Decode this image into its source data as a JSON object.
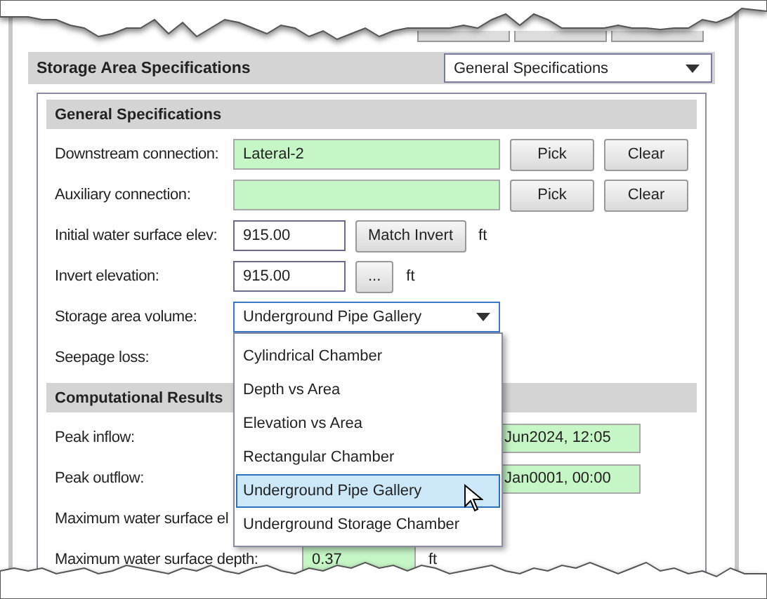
{
  "toolbar": {
    "buttons": [
      {
        "kind": "button"
      },
      {
        "kind": "button"
      },
      {
        "kind": "button"
      }
    ]
  },
  "panel": {
    "title": "Storage Area Specifications",
    "view_select": {
      "value": "General Specifications"
    }
  },
  "general": {
    "title": "General Specifications",
    "rows": [
      {
        "kind": "connection",
        "label": "Downstream connection:",
        "value": "Lateral-2",
        "buttons": [
          "Pick",
          "Clear"
        ]
      },
      {
        "kind": "connection",
        "label": "Auxiliary connection:",
        "buttons": [
          "Pick",
          "Clear"
        ]
      },
      {
        "kind": "elevation",
        "label": "Initial water surface elev:",
        "value": "915.00",
        "button": "Match Invert",
        "unit": "ft"
      },
      {
        "kind": "elevation",
        "label": "Invert elevation:",
        "value": "915.00",
        "button": "...",
        "unit": "ft"
      },
      {
        "kind": "select",
        "label": "Storage area volume:",
        "value": "Underground Pipe Gallery"
      },
      {
        "kind": "label",
        "label": "Seepage loss:"
      }
    ]
  },
  "volume_options": [
    {
      "label": "Cylindrical Chamber",
      "selected": false
    },
    {
      "label": "Depth vs Area",
      "selected": false
    },
    {
      "label": "Elevation vs Area",
      "selected": false
    },
    {
      "label": "Rectangular Chamber",
      "selected": false
    },
    {
      "label": "Underground Pipe Gallery",
      "selected": true
    },
    {
      "label": "Underground Storage Chamber",
      "selected": false
    }
  ],
  "results": {
    "title": "Computational Results",
    "rows": [
      {
        "kind": "hidden",
        "label": "Peak inflow:",
        "value": "Jun2024, 12:05"
      },
      {
        "kind": "hidden",
        "label": "Peak outflow:",
        "value": "Jan0001, 00:00"
      },
      {
        "kind": "label",
        "label": "Maximum water surface el"
      },
      {
        "kind": "value",
        "label": "Maximum water surface depth:",
        "value": "0.37",
        "unit": "ft"
      }
    ]
  }
}
